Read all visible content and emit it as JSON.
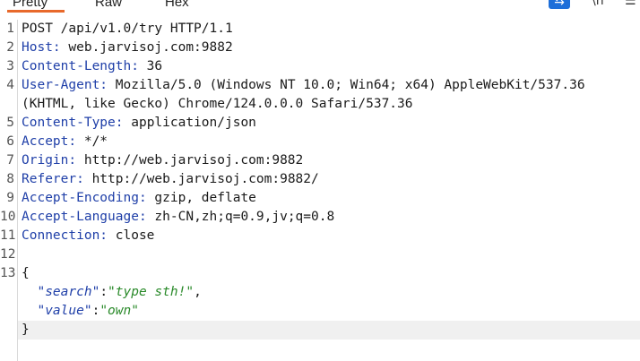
{
  "tabs": {
    "pretty": "Pretty",
    "raw": "Raw",
    "hex": "Hex"
  },
  "toolbar": {
    "wrap_icon_glyph": "⇆",
    "newline_icon_glyph": "\\n",
    "menu_icon_glyph": "☰",
    "wrap_icon": "word-wrap-icon",
    "newline_icon": "show-newlines-icon",
    "menu_icon": "hamburger-menu-icon"
  },
  "colors": {
    "header_name": "#1f3fa8",
    "json_key": "#1f3fa8",
    "json_value": "#2a8a2a",
    "tab_underline": "#e8692b",
    "wrap_icon_bg": "#1e6fd9"
  },
  "request": {
    "lines": [
      {
        "num": "1",
        "text": "POST /api/v1.0/try HTTP/1.1"
      },
      {
        "num": "2",
        "name": "Host:",
        "value": " web.jarvisoj.com:9882"
      },
      {
        "num": "3",
        "name": "Content-Length:",
        "value": " 36"
      },
      {
        "num": "4",
        "name": "User-Agent:",
        "value": " Mozilla/5.0 (Windows NT 10.0; Win64; x64) AppleWebKit/537.36"
      },
      {
        "num": "",
        "text": "(KHTML, like Gecko) Chrome/124.0.0.0 Safari/537.36"
      },
      {
        "num": "5",
        "name": "Content-Type:",
        "value": " application/json"
      },
      {
        "num": "6",
        "name": "Accept:",
        "value": " */*"
      },
      {
        "num": "7",
        "name": "Origin:",
        "value": " http://web.jarvisoj.com:9882"
      },
      {
        "num": "8",
        "name": "Referer:",
        "value": " http://web.jarvisoj.com:9882/"
      },
      {
        "num": "9",
        "name": "Accept-Encoding:",
        "value": " gzip, deflate"
      },
      {
        "num": "10",
        "name": "Accept-Language:",
        "value": " zh-CN,zh;q=0.9,jv;q=0.8"
      },
      {
        "num": "11",
        "name": "Connection:",
        "value": " close"
      },
      {
        "num": "12",
        "text": ""
      },
      {
        "num": "13",
        "text": "{"
      },
      {
        "num": "",
        "indent": "  ",
        "key": "\"search\"",
        "sep": ":",
        "val": "\"type sth!\"",
        "tail": ","
      },
      {
        "num": "",
        "indent": "  ",
        "key": "\"value\"",
        "sep": ":",
        "val": "\"own\"",
        "tail": ""
      },
      {
        "num": "",
        "text": "}"
      }
    ]
  }
}
